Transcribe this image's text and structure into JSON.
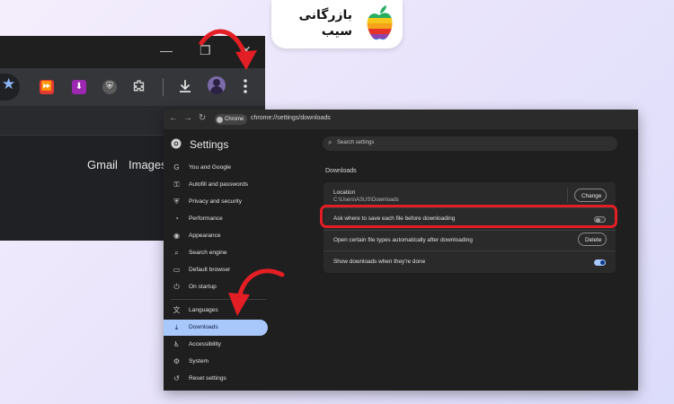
{
  "background_browser": {
    "window_controls": {
      "minimize": "—",
      "maximize": "❐",
      "close": "✕"
    },
    "links": [
      "Gmail",
      "Images"
    ],
    "icons": [
      "star-icon",
      "extension-red-icon",
      "extension-download-icon",
      "extension-shield-icon",
      "extensions-puzzle-icon",
      "downloads-icon",
      "profile-avatar",
      "menu-kebab-icon"
    ]
  },
  "logo": {
    "text": "بازرگانی سیب",
    "brand_colors": [
      "#f6a21a",
      "#e5332a",
      "#8e44ad",
      "#2e86de",
      "#27ae60"
    ]
  },
  "nav": {
    "back": "←",
    "forward": "→",
    "reload": "↻",
    "chip_label": "Chrome",
    "url": "chrome://settings/downloads"
  },
  "settings": {
    "title": "Settings",
    "search_placeholder": "Search settings",
    "sidebar": [
      {
        "label": "You and Google",
        "icon": "G",
        "active": false
      },
      {
        "label": "Autofill and passwords",
        "icon": "⚿",
        "active": false
      },
      {
        "label": "Privacy and security",
        "icon": "⛨",
        "active": false
      },
      {
        "label": "Performance",
        "icon": "◔",
        "active": false
      },
      {
        "label": "Appearance",
        "icon": "◉",
        "active": false
      },
      {
        "label": "Search engine",
        "icon": "⌕",
        "active": false
      },
      {
        "label": "Default browser",
        "icon": "▭",
        "active": false
      },
      {
        "label": "On startup",
        "icon": "⏻",
        "active": false
      },
      {
        "label": "Languages",
        "icon": "文",
        "active": false
      },
      {
        "label": "Downloads",
        "icon": "⤓",
        "active": true
      },
      {
        "label": "Accessibility",
        "icon": "♿",
        "active": false
      },
      {
        "label": "System",
        "icon": "⚙",
        "active": false
      },
      {
        "label": "Reset settings",
        "icon": "↺",
        "active": false
      }
    ],
    "downloads": {
      "section_title": "Downloads",
      "location_label": "Location",
      "location_value": "C:\\Users\\ASUS\\Downloads",
      "change_button": "Change",
      "ask_where_label": "Ask where to save each file before downloading",
      "ask_where_enabled": false,
      "open_types_label": "Open certain file types automatically after downloading",
      "delete_button": "Delete",
      "show_when_done_label": "Show downloads when they're done",
      "show_when_done_enabled": true
    }
  },
  "colors": {
    "accent": "#a8c7fa",
    "highlight": "#e31e24",
    "window_bg": "#1f1f1f",
    "card_bg": "#2a2a2a"
  }
}
